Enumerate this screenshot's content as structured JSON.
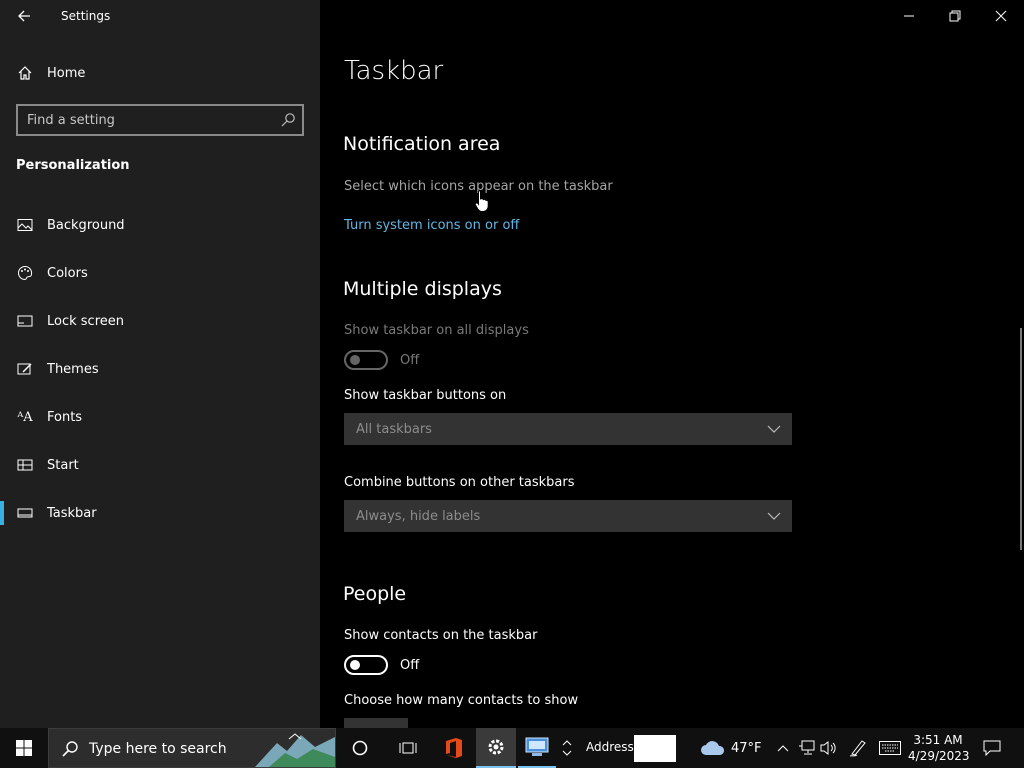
{
  "window": {
    "title": "Settings"
  },
  "sidebar": {
    "home_label": "Home",
    "search_placeholder": "Find a setting",
    "section": "Personalization",
    "items": [
      {
        "label": "Background",
        "icon": "background-icon"
      },
      {
        "label": "Colors",
        "icon": "palette-icon"
      },
      {
        "label": "Lock screen",
        "icon": "lock-screen-icon"
      },
      {
        "label": "Themes",
        "icon": "themes-icon"
      },
      {
        "label": "Fonts",
        "icon": "fonts-icon"
      },
      {
        "label": "Start",
        "icon": "start-icon"
      },
      {
        "label": "Taskbar",
        "icon": "taskbar-icon",
        "selected": true
      }
    ]
  },
  "main": {
    "page_title": "Taskbar",
    "notification_area": {
      "heading": "Notification area",
      "select_icons_link": "Select which icons appear on the taskbar",
      "system_icons_link": "Turn system icons on or off"
    },
    "multiple_displays": {
      "heading": "Multiple displays",
      "show_all_label": "Show taskbar on all displays",
      "show_all_state": "Off",
      "buttons_on_label": "Show taskbar buttons on",
      "buttons_on_value": "All taskbars",
      "combine_label": "Combine buttons on other taskbars",
      "combine_value": "Always, hide labels"
    },
    "people": {
      "heading": "People",
      "show_contacts_label": "Show contacts on the taskbar",
      "show_contacts_state": "Off",
      "how_many_label": "Choose how many contacts to show"
    }
  },
  "taskbar": {
    "search_placeholder": "Type here to search",
    "address_label": "Address",
    "weather_temp": "47°F",
    "time": "3:51 AM",
    "date": "4/29/2023"
  },
  "colors": {
    "accent": "#3ab0e2",
    "link": "#63b7e6",
    "sidebar_bg": "#1f1f1f",
    "content_bg": "#000000"
  }
}
